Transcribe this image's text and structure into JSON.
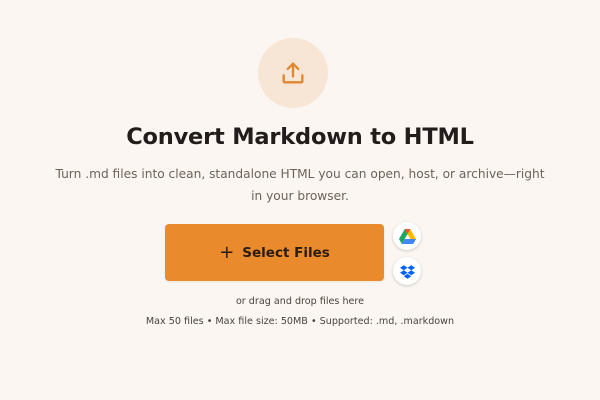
{
  "hero": {
    "icon": "upload-icon",
    "title": "Convert Markdown to HTML",
    "subtitle": "Turn .md files into clean, standalone HTML you can open, host, or archive—right in your browser."
  },
  "upload": {
    "select_label": "Select Files",
    "select_icon": "plus-icon",
    "drag_hint": "or drag and drop files here",
    "limits": "Max 50 files • Max file size: 50MB • Supported: .md, .markdown"
  },
  "cloud_sources": [
    {
      "icon": "google-drive-icon"
    },
    {
      "icon": "dropbox-icon"
    }
  ],
  "colors": {
    "background": "#fbf6f1",
    "accent": "#e98a2c",
    "icon_circle": "#f7e6d6"
  }
}
